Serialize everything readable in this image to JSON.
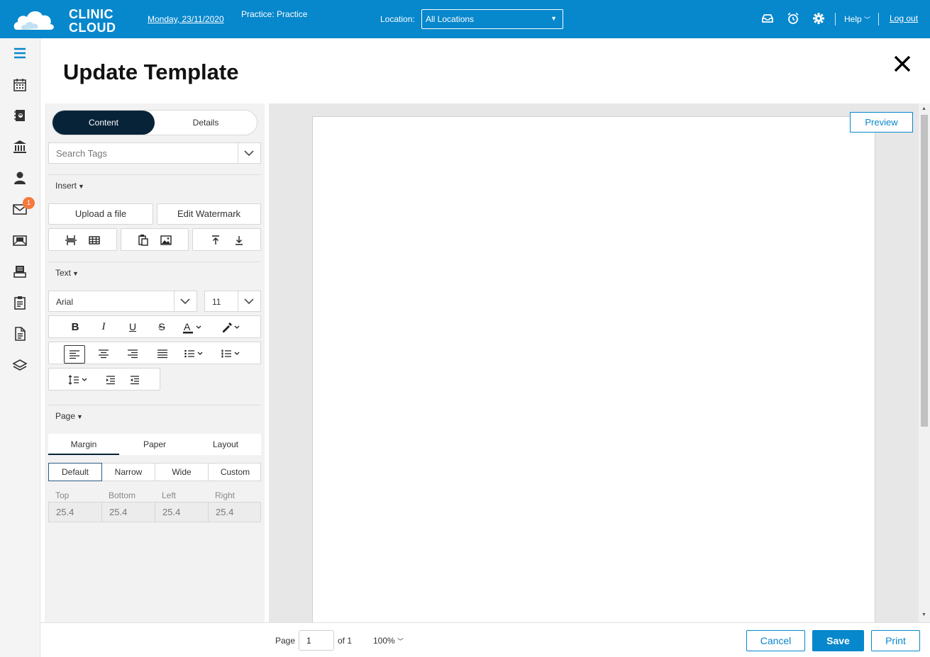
{
  "colors": {
    "brand": "#0787cc",
    "dark": "#072338",
    "badge": "#f5793b"
  },
  "header": {
    "logo_text": "CLINIC CLOUD",
    "date": "Monday, 23/11/2020",
    "practice": "Practice: Practice",
    "location_label": "Location:",
    "location_value": "All Locations",
    "help": "Help",
    "logout": "Log out",
    "icons": [
      "inbox-icon",
      "alarm-clock-icon",
      "gear-icon"
    ]
  },
  "rail": {
    "items": [
      "menu-icon",
      "calendar-icon",
      "contacts-icon",
      "institution-icon",
      "person-icon",
      "mail-icon",
      "mail-open-icon",
      "inbox-tray-icon",
      "clipboard-icon",
      "document-icon",
      "layers-icon"
    ],
    "mail_badge": "1"
  },
  "page": {
    "title": "Update Template"
  },
  "panel": {
    "tabs": {
      "content": "Content",
      "details": "Details"
    },
    "search_tags": "Search Tags",
    "insert": {
      "label": "Insert",
      "upload": "Upload a file",
      "watermark": "Edit Watermark"
    },
    "text": {
      "label": "Text",
      "font": "Arial",
      "size": "11"
    },
    "page": {
      "label": "Page",
      "tabs": [
        "Margin",
        "Paper",
        "Layout"
      ],
      "margin_options": [
        "Default",
        "Narrow",
        "Wide",
        "Custom"
      ],
      "margin_labels": [
        "Top",
        "Bottom",
        "Left",
        "Right"
      ],
      "margin_values": [
        "25.4",
        "25.4",
        "25.4",
        "25.4"
      ]
    }
  },
  "editor": {
    "preview": "Preview"
  },
  "footer": {
    "page_label": "Page",
    "page_value": "1",
    "of_label": "of 1",
    "zoom": "100%",
    "cancel": "Cancel",
    "save": "Save",
    "print": "Print"
  }
}
